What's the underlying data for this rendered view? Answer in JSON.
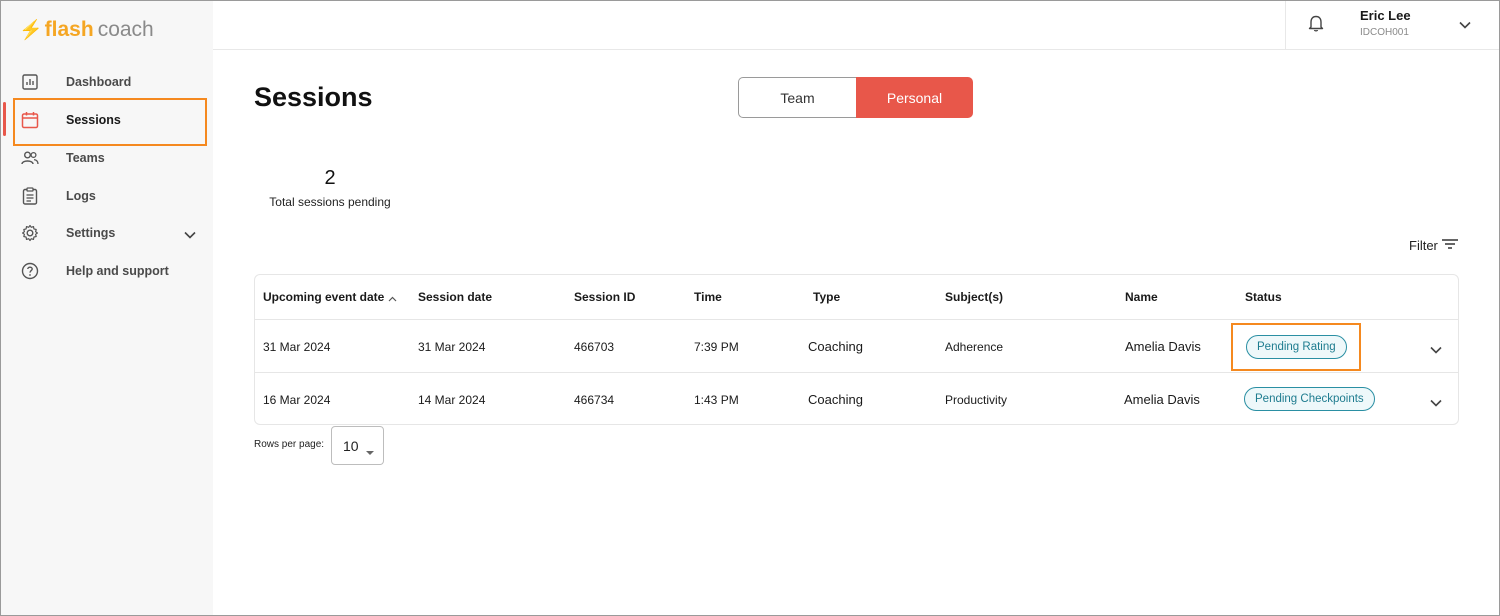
{
  "brand": {
    "name_part1": "flash",
    "name_part2": "coach",
    "accent": "#f5a623"
  },
  "sidebar": {
    "items": [
      {
        "label": "Dashboard",
        "icon": "bar-chart-icon"
      },
      {
        "label": "Sessions",
        "icon": "calendar-icon",
        "active": true
      },
      {
        "label": "Teams",
        "icon": "people-icon"
      },
      {
        "label": "Logs",
        "icon": "clipboard-icon"
      },
      {
        "label": "Settings",
        "icon": "gear-icon"
      },
      {
        "label": "Help and support",
        "icon": "help-circle-icon"
      }
    ]
  },
  "header": {
    "user_name": "Eric Lee",
    "user_id": "IDCOH001"
  },
  "page": {
    "title": "Sessions",
    "toggle": {
      "team": "Team",
      "personal": "Personal",
      "selected": "Personal"
    },
    "stats": {
      "value": "2",
      "label": "Total sessions pending"
    },
    "filter_label": "Filter"
  },
  "table": {
    "columns": [
      "Upcoming event date",
      "Session date",
      "Session ID",
      "Time",
      "Type",
      "Subject(s)",
      "Name",
      "Status"
    ],
    "rows": [
      {
        "upcoming": "31 Mar 2024",
        "session_date": "31 Mar 2024",
        "session_id": "466703",
        "time": "7:39 PM",
        "type": "Coaching",
        "subject": "Adherence",
        "name": "Amelia Davis",
        "status": "Pending Rating"
      },
      {
        "upcoming": "16 Mar 2024",
        "session_date": "14 Mar 2024",
        "session_id": "466734",
        "time": "1:43 PM",
        "type": "Coaching",
        "subject": "Productivity",
        "name": "Amelia Davis",
        "status": "Pending Checkpoints"
      }
    ]
  },
  "pagination": {
    "rows_per_page_label": "Rows per page:",
    "rows_per_page_value": "10"
  },
  "colors": {
    "primary": "#e8574a",
    "badge": "#1e7c8f",
    "highlight": "#f5891f"
  }
}
